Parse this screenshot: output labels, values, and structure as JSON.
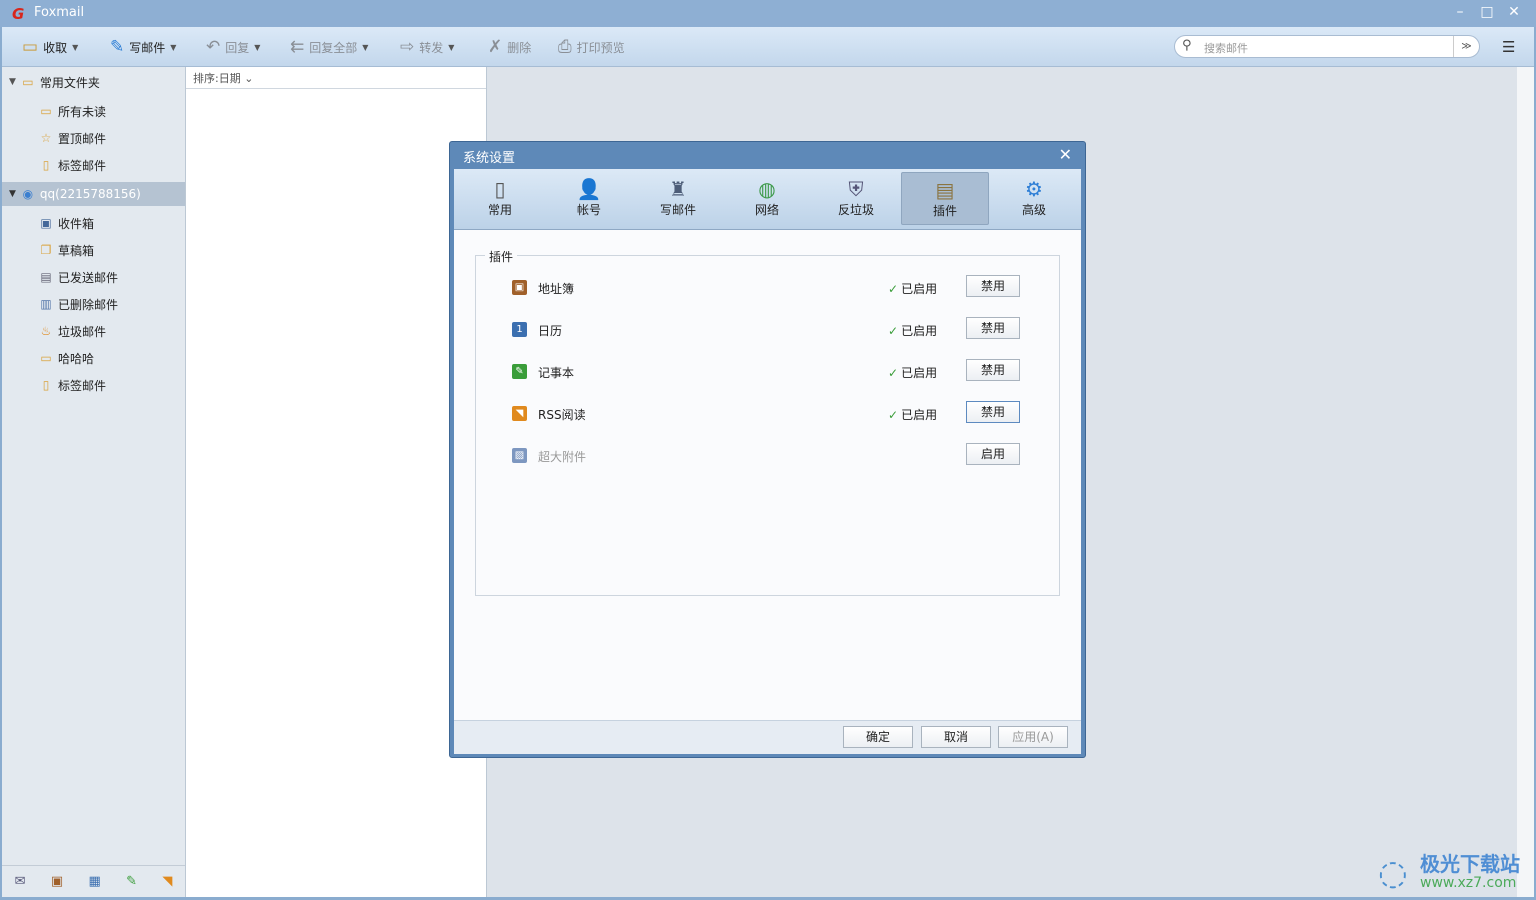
{
  "app": {
    "title": "Foxmail"
  },
  "toolbar": {
    "receive": "收取",
    "compose": "写邮件",
    "reply": "回复",
    "reply_all": "回复全部",
    "forward": "转发",
    "delete": "删除",
    "print_preview": "打印预览",
    "search_placeholder": "搜索邮件"
  },
  "sidebar": {
    "common_folders": "常用文件夹",
    "common_items": [
      "所有未读",
      "置顶邮件",
      "标签邮件"
    ],
    "account": "qq(2215788156)",
    "account_items": [
      "收件箱",
      "草稿箱",
      "已发送邮件",
      "已删除邮件",
      "垃圾邮件",
      "哈哈哈",
      "标签邮件"
    ]
  },
  "list": {
    "sort_label": "排序:日期"
  },
  "dialog": {
    "title": "系统设置",
    "tabs": [
      "常用",
      "帐号",
      "写邮件",
      "网络",
      "反垃圾",
      "插件",
      "高级"
    ],
    "active_tab": "插件",
    "group_label": "插件",
    "plugins": [
      {
        "name": "地址簿",
        "status": "已启用",
        "action": "禁用"
      },
      {
        "name": "日历",
        "status": "已启用",
        "action": "禁用"
      },
      {
        "name": "记事本",
        "status": "已启用",
        "action": "禁用"
      },
      {
        "name": "RSS阅读",
        "status": "已启用",
        "action": "禁用"
      },
      {
        "name": "超大附件",
        "status": "",
        "action": "启用"
      }
    ],
    "ok": "确定",
    "cancel": "取消",
    "apply": "应用(A)"
  },
  "watermark": {
    "name": "极光下载站",
    "url": "www.xz7.com"
  },
  "colors": {
    "titlebar": "#8eafd3",
    "dialog_frame": "#5e89b8",
    "enabled_check": "#3a9d3a"
  }
}
